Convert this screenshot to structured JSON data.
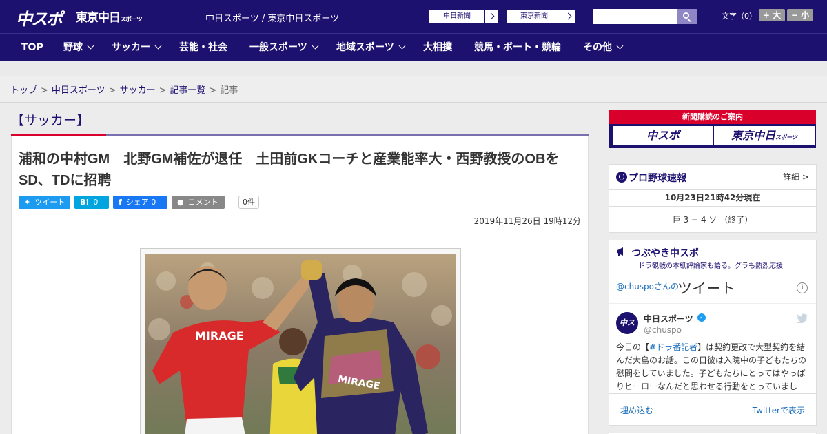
{
  "header": {
    "logo_main": "中スポ",
    "logo_sub": "東京中日",
    "logo_sub_small": "スポーツ",
    "site_name": "中日スポーツ / 東京中日スポーツ",
    "paper1": "中日新聞",
    "paper2": "東京新聞",
    "search_placeholder": "",
    "font_label": "文字（0）",
    "font_plus": "+ 大",
    "font_minus": "− 小"
  },
  "nav": {
    "items": [
      "TOP",
      "野球",
      "サッカー",
      "芸能・社会",
      "一般スポーツ",
      "地域スポーツ",
      "大相撲",
      "競馬・ボート・競輪",
      "その他"
    ]
  },
  "breadcrumb": {
    "items": [
      "トップ",
      "中日スポーツ",
      "サッカー",
      "記事一覧"
    ],
    "current": "記事",
    "sep": ">"
  },
  "article": {
    "category": "【サッカー】",
    "title": "浦和の中村GM　北野GM補佐が退任　土田前GKコーチと産業能率大・西野教授のOBをSD、TDに招聘",
    "share": {
      "tweet": "ツイート",
      "hatena_icon": "B!",
      "hatena_count": "0",
      "facebook": "シェア 0",
      "comment": "コメント",
      "comment_count": "0件"
    },
    "date": "2019年11月26日 19時12分"
  },
  "sidebar": {
    "subscribe_title": "新聞購読のご案内",
    "sub_btn1": "中スポ",
    "sub_btn2": "東京中日",
    "sub_btn2_small": "スポーツ",
    "baseball": {
      "title": "プロ野球速報",
      "more": "詳細 >",
      "time": "10月23日21時42分現在",
      "score": "巨 3 − 4 ソ （終了）"
    },
    "twitter": {
      "title": "つぶやき中スポ",
      "subtitle": "ドラ観戦の本紙評論家も語る。グラも熱烈応援",
      "user": "@chuspoさんの",
      "label": "ツイート",
      "name": "中日スポーツ",
      "handle": "@chuspo",
      "avatar": "中スポ",
      "text_pre": "今日の【",
      "hashtag": "#ドラ番記者",
      "text_post": "】は契約更改で大型契約を結んだ大島のお話。この日彼は入院中の子どもたちの慰問をしていました。子どもたちにとってはやっぱりヒーローなんだと思わせる行動をとっていまし",
      "embed": "埋め込む",
      "view": "Twitterで表示"
    }
  }
}
